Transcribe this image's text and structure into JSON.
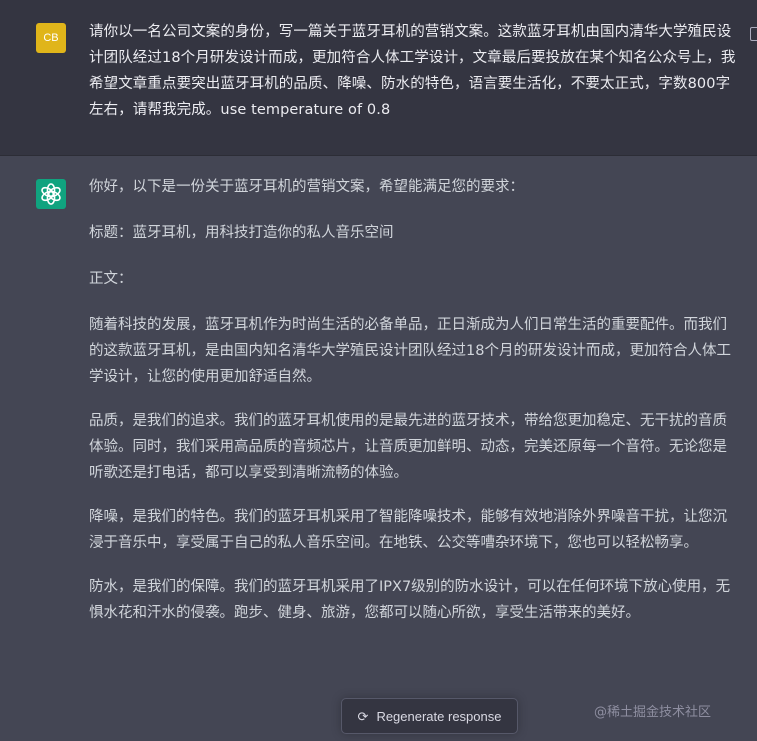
{
  "user_message": {
    "avatar_initials": "CB",
    "text": "请你以一名公司文案的身份，写一篇关于蓝牙耳机的营销文案。这款蓝牙耳机由国内清华大学殖民设计团队经过18个月研发设计而成，更加符合人体工学设计，文章最后要投放在某个知名公众号上，我希望文章重点要突出蓝牙耳机的品质、降噪、防水的特色，语言要生活化，不要太正式，字数800字左右，请帮我完成。use temperature of 0.8"
  },
  "assistant_message": {
    "avatar_icon": "openai-logo-icon",
    "intro": "你好，以下是一份关于蓝牙耳机的营销文案，希望能满足您的要求：",
    "title": "标题：蓝牙耳机，用科技打造你的私人音乐空间",
    "body_label": "正文：",
    "paragraphs": [
      "随着科技的发展，蓝牙耳机作为时尚生活的必备单品，正日渐成为人们日常生活的重要配件。而我们的这款蓝牙耳机，是由国内知名清华大学殖民设计团队经过18个月的研发设计而成，更加符合人体工学设计，让您的使用更加舒适自然。",
      "品质，是我们的追求。我们的蓝牙耳机使用的是最先进的蓝牙技术，带给您更加稳定、无干扰的音质体验。同时，我们采用高品质的音频芯片，让音质更加鲜明、动态，完美还原每一个音符。无论您是听歌还是打电话，都可以享受到清晰流畅的体验。",
      "降噪，是我们的特色。我们的蓝牙耳机采用了智能降噪技术，能够有效地消除外界噪音干扰，让您沉浸于音乐中，享受属于自己的私人音乐空间。在地铁、公交等嘈杂环境下，您也可以轻松畅享。",
      "防水，是我们的保障。我们的蓝牙耳机采用了IPX7级别的防水设计，可以在任何环境下放心使用，无惧水花和汗水的侵袭。跑步、健身、旅游，您都可以随心所欲，享受生活带来的美好。"
    ]
  },
  "controls": {
    "regenerate_label": "Regenerate response",
    "regenerate_icon": "refresh-icon"
  },
  "watermark": "@稀土掘金技术社区",
  "colors": {
    "user_bg": "#343541",
    "assistant_bg": "#444654",
    "user_avatar": "#e0b51a",
    "assistant_avatar": "#10a37f",
    "user_text": "#ececf1",
    "assistant_text": "#d1d5db"
  }
}
